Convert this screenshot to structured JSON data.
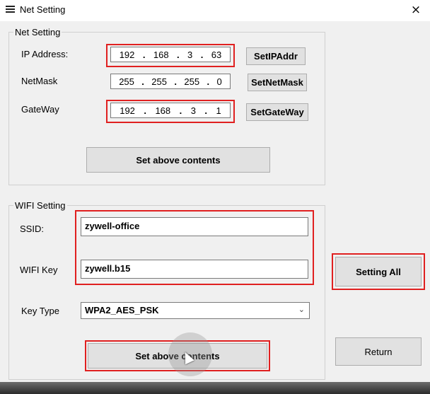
{
  "window": {
    "title": "Net Setting",
    "close_glyph": "×",
    "icon": "menu-lines-icon"
  },
  "net_setting": {
    "legend": "Net Setting",
    "ip": {
      "label": "IP Address:",
      "octets": [
        "192",
        "168",
        "3",
        "63"
      ],
      "button": "SetIPAddr"
    },
    "netmask": {
      "label": "NetMask",
      "octets": [
        "255",
        "255",
        "255",
        "0"
      ],
      "button": "SetNetMask"
    },
    "gateway": {
      "label": "GateWay",
      "octets": [
        "192",
        "168",
        "3",
        "1"
      ],
      "button": "SetGateWay"
    },
    "set_button": "Set above contents"
  },
  "wifi_setting": {
    "legend": "WIFI Setting",
    "ssid": {
      "label": "SSID:",
      "value": "zywell-office"
    },
    "key": {
      "label": "WIFI Key",
      "value": "zywell.b15"
    },
    "key_type": {
      "label": "Key Type",
      "value": "WPA2_AES_PSK"
    },
    "set_button": "Set above contents"
  },
  "actions": {
    "setting_all": "Setting All",
    "return": "Return"
  },
  "colors": {
    "highlight": "#e02020",
    "window_bg": "#f0f0f0",
    "button_bg": "#e1e1e1"
  }
}
